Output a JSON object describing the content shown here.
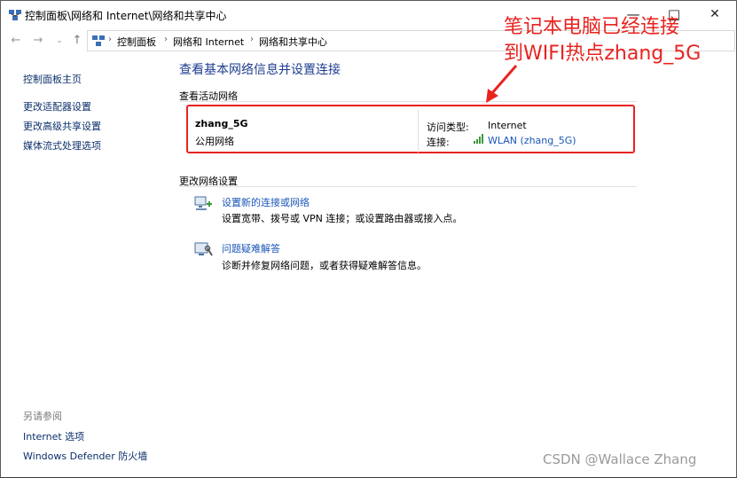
{
  "window": {
    "title": "控制面板\\网络和 Internet\\网络和共享中心",
    "min_glyph": "—",
    "max_glyph": "□",
    "close_glyph": "✕"
  },
  "nav": {
    "back": "←",
    "forward": "→",
    "recent": "⌄",
    "up": "↑",
    "breadcrumbs": [
      "控制面板",
      "网络和 Internet",
      "网络和共享中心"
    ],
    "separator": "›"
  },
  "sidebar": {
    "items": [
      {
        "label": "控制面板主页"
      },
      {
        "label": "更改适配器设置"
      },
      {
        "label": "更改高级共享设置"
      },
      {
        "label": "媒体流式处理选项"
      }
    ],
    "see_also_title": "另请参阅",
    "see_also": [
      {
        "label": "Internet 选项"
      },
      {
        "label": "Windows Defender 防火墙"
      }
    ]
  },
  "main": {
    "title": "查看基本网络信息并设置连接",
    "active_section": "查看活动网络",
    "network": {
      "name": "zhang_5G",
      "category": "公用网络",
      "access_type_label": "访问类型:",
      "access_type_value": "Internet",
      "connection_label": "连接:",
      "connection_value": "WLAN (zhang_5G)"
    },
    "change_section": "更改网络设置",
    "tasks": [
      {
        "icon": "new-connection-icon",
        "link": "设置新的连接或网络",
        "desc": "设置宽带、拨号或 VPN 连接；或设置路由器或接入点。"
      },
      {
        "icon": "troubleshoot-icon",
        "link": "问题疑难解答",
        "desc": "诊断并修复网络问题，或者获得疑难解答信息。"
      }
    ]
  },
  "annotation": {
    "line1": "笔记本电脑已经连接",
    "line2": "到WIFI热点zhang_5G",
    "color": "#e8231f"
  },
  "watermark": "CSDN @Wallace Zhang",
  "colors": {
    "link": "#1a56b8",
    "title": "#1e3d8f",
    "highlight": "#e8231f"
  }
}
